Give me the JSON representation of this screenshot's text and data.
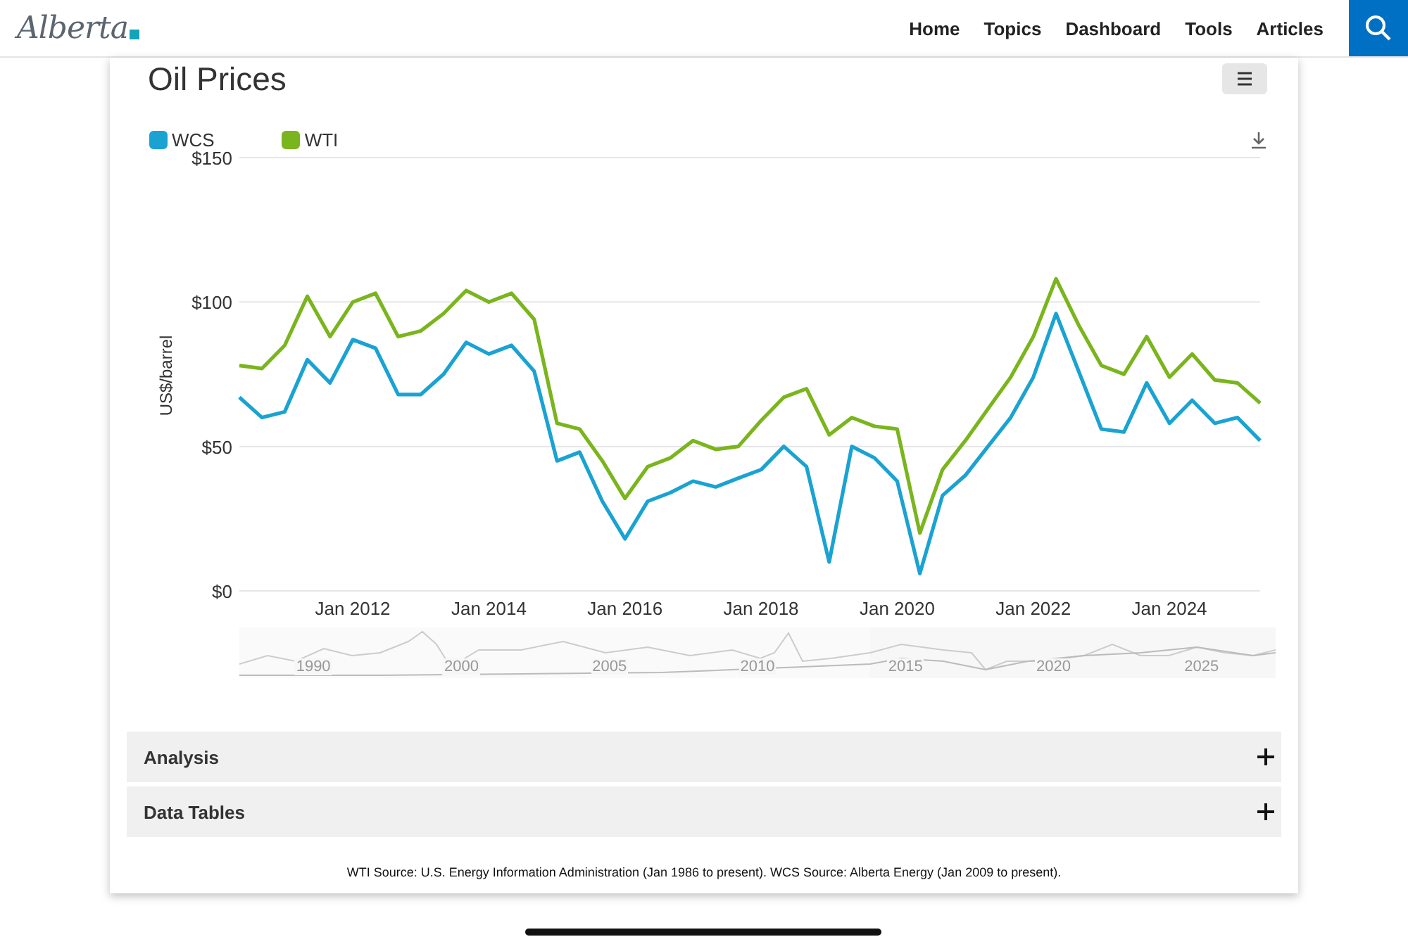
{
  "header": {
    "logo": "Alberta",
    "nav": [
      {
        "label": "Home"
      },
      {
        "label": "Topics"
      },
      {
        "label": "Dashboard"
      },
      {
        "label": "Tools"
      },
      {
        "label": "Articles"
      }
    ]
  },
  "card": {
    "title": "Oil Prices",
    "chart_data": {
      "type": "line",
      "ylabel": "US$/barrel",
      "ylim": [
        0,
        150
      ],
      "yticks": [
        {
          "value": 0,
          "label": "$0"
        },
        {
          "value": 50,
          "label": "$50"
        },
        {
          "value": 100,
          "label": "$100"
        },
        {
          "value": 150,
          "label": "$150"
        }
      ],
      "categories": [
        null,
        null,
        null,
        null,
        null,
        "Jan 2012",
        null,
        null,
        null,
        null,
        null,
        "Jan 2014",
        null,
        null,
        null,
        null,
        null,
        "Jan 2016",
        null,
        null,
        null,
        null,
        null,
        "Jan 2018",
        null,
        null,
        null,
        null,
        null,
        "Jan 2020",
        null,
        null,
        null,
        null,
        null,
        "Jan 2022",
        null,
        null,
        null,
        null,
        null,
        "Jan 2024",
        null,
        null,
        null,
        null
      ],
      "series": [
        {
          "name": "WCS",
          "color": "#1aa3d2",
          "values": [
            67,
            60,
            62,
            80,
            72,
            87,
            84,
            68,
            68,
            75,
            86,
            82,
            85,
            76,
            45,
            48,
            31,
            18,
            31,
            34,
            38,
            36,
            39,
            42,
            50,
            43,
            10,
            50,
            46,
            38,
            6,
            33,
            40,
            50,
            60,
            74,
            96,
            76,
            56,
            55,
            72,
            58,
            66,
            58,
            60,
            52
          ]
        },
        {
          "name": "WTI",
          "color": "#7ab51d",
          "values": [
            78,
            77,
            85,
            102,
            88,
            100,
            103,
            88,
            90,
            96,
            104,
            100,
            103,
            94,
            58,
            56,
            45,
            32,
            43,
            46,
            52,
            49,
            50,
            59,
            67,
            70,
            54,
            60,
            57,
            56,
            20,
            42,
            52,
            63,
            74,
            88,
            108,
            92,
            78,
            75,
            88,
            74,
            82,
            73,
            72,
            65
          ]
        }
      ]
    },
    "navigator_labels": [
      "1990",
      "2000",
      "2005",
      "2010",
      "2015",
      "2020",
      "2025"
    ],
    "sections": [
      {
        "label": "Analysis",
        "expanded": false
      },
      {
        "label": "Data Tables",
        "expanded": false
      }
    ],
    "source": "WTI Source: U.S. Energy Information Administration (Jan 1986 to present). WCS Source: Alberta Energy (Jan 2009 to present)."
  }
}
